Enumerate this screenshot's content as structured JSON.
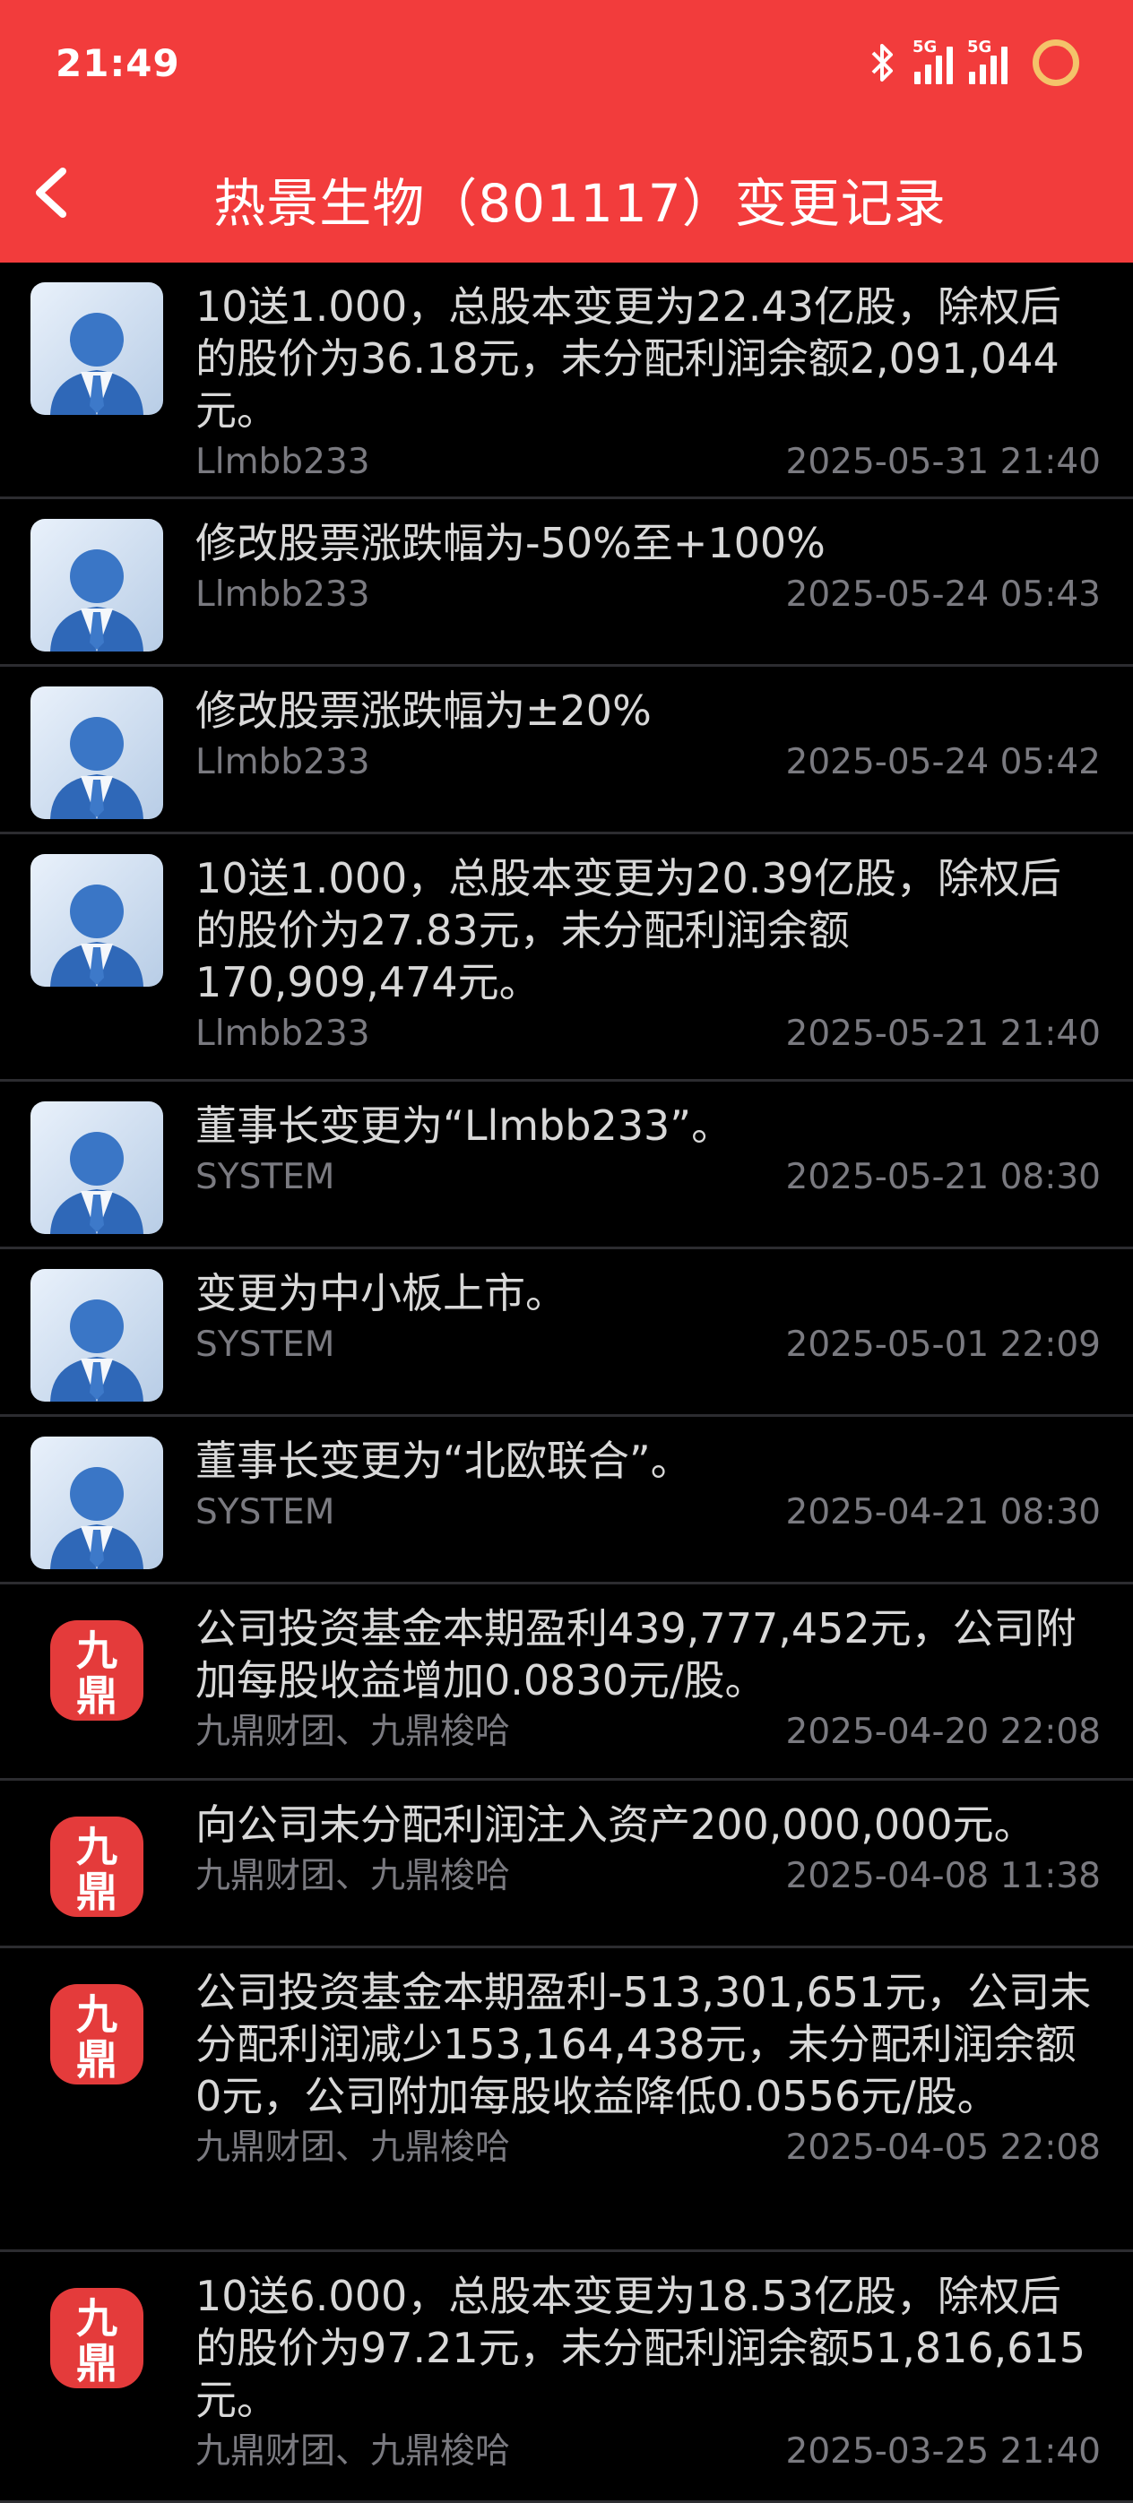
{
  "status": {
    "time": "21:49",
    "net1": "5G",
    "net2": "5G"
  },
  "header": {
    "title": "热景生物（801117）变更记录"
  },
  "records": [
    {
      "avatar": "person",
      "text": "10送1.000，总股本变更为22.43亿股，除权后的股价为36.18元，未分配利润余额2,091,044元。",
      "user": "Llmbb233",
      "time": "2025-05-31 21:40"
    },
    {
      "avatar": "person",
      "text": "修改股票涨跌幅为-50%至+100%",
      "user": "Llmbb233",
      "time": "2025-05-24 05:43"
    },
    {
      "avatar": "person",
      "text": "修改股票涨跌幅为±20%",
      "user": "Llmbb233",
      "time": "2025-05-24 05:42"
    },
    {
      "avatar": "person",
      "text": "10送1.000，总股本变更为20.39亿股，除权后的股价为27.83元，未分配利润余额170,909,474元。",
      "user": "Llmbb233",
      "time": "2025-05-21 21:40"
    },
    {
      "avatar": "person",
      "text": "董事长变更为“Llmbb233”。",
      "user": "SYSTEM",
      "time": "2025-05-21 08:30"
    },
    {
      "avatar": "person",
      "text": "变更为中小板上市。",
      "user": "SYSTEM",
      "time": "2025-05-01 22:09"
    },
    {
      "avatar": "person",
      "text": "董事长变更为“北欧联合”。",
      "user": "SYSTEM",
      "time": "2025-04-21 08:30"
    },
    {
      "avatar": "jiuding",
      "logo_text": "九鼎",
      "text": "公司投资基金本期盈利439,777,452元，公司附加每股收益增加0.0830元/股。",
      "user": "九鼎财团、九鼎梭哈",
      "time": "2025-04-20 22:08"
    },
    {
      "avatar": "jiuding",
      "logo_text": "九鼎",
      "text": "向公司未分配利润注入资产200,000,000元。",
      "user": "九鼎财团、九鼎梭哈",
      "time": "2025-04-08 11:38"
    },
    {
      "avatar": "jiuding",
      "logo_text": "九鼎",
      "text": "公司投资基金本期盈利-513,301,651元，公司未分配利润减少153,164,438元，未分配利润余额0元，公司附加每股收益降低0.0556元/股。",
      "user": "九鼎财团、九鼎梭哈",
      "time": "2025-04-05 22:08"
    },
    {
      "avatar": "jiuding",
      "logo_text": "九鼎",
      "text": "10送6.000，总股本变更为18.53亿股，除权后的股价为97.21元，未分配利润余额51,816,615元。",
      "user": "九鼎财团、九鼎梭哈",
      "time": "2025-03-25 21:40"
    }
  ]
}
